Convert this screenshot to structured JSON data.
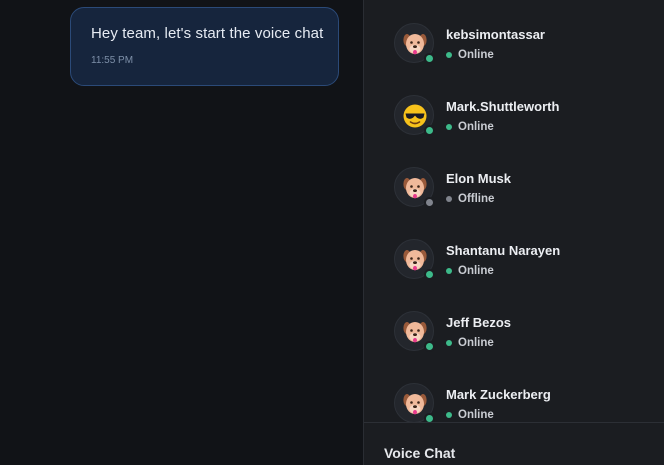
{
  "chat": {
    "message": {
      "text": "Hey team, let's start the voice chat",
      "time": "11:55 PM"
    }
  },
  "members": [
    {
      "name": "kebsimontassar",
      "status": "Online",
      "avatar_icon": "dog-face-icon"
    },
    {
      "name": "Mark.Shuttleworth",
      "status": "Online",
      "avatar_icon": "sunglasses-face-icon"
    },
    {
      "name": "Elon Musk",
      "status": "Offline",
      "avatar_icon": "dog-face-icon"
    },
    {
      "name": "Shantanu Narayen",
      "status": "Online",
      "avatar_icon": "dog-face-icon"
    },
    {
      "name": "Jeff Bezos",
      "status": "Online",
      "avatar_icon": "dog-face-icon"
    },
    {
      "name": "Mark Zuckerberg",
      "status": "Online",
      "avatar_icon": "dog-face-icon"
    }
  ],
  "voice": {
    "title": "Voice Chat"
  },
  "colors": {
    "online": "#3dba8a",
    "offline": "#80848d",
    "bubble_bg": "#16253d",
    "bubble_border": "#2b4a78"
  }
}
